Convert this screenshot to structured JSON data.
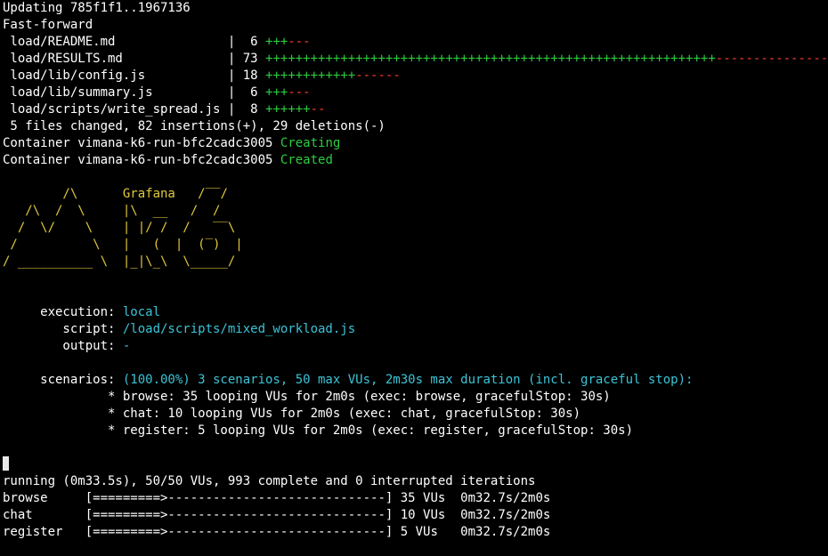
{
  "git": {
    "updating": "Updating 785f1f1..1967136",
    "fast_forward": "Fast-forward",
    "files": [
      {
        "name": " load/README.md              ",
        "sep": " |  ",
        "count": "6",
        "plus": "+++",
        "minus": "---"
      },
      {
        "name": " load/RESULTS.md             ",
        "sep": " | ",
        "count": "73",
        "plus": "++++++++++++++++++++++++++++++++++++++++++++++++++++++++++++",
        "minus": "----------------"
      },
      {
        "name": " load/lib/config.js          ",
        "sep": " | ",
        "count": "18",
        "plus": "++++++++++++",
        "minus": "------"
      },
      {
        "name": " load/lib/summary.js         ",
        "sep": " |  ",
        "count": "6",
        "plus": "+++",
        "minus": "---"
      },
      {
        "name": " load/scripts/write_spread.js",
        "sep": " |  ",
        "count": "8",
        "plus": "++++++",
        "minus": "--"
      }
    ],
    "summary": " 5 files changed, 82 insertions(+), 29 deletions(-)"
  },
  "docker": {
    "lines": [
      {
        "prefix": "Container vimana-k6-run-bfc2cadc3005 ",
        "status": "Creating"
      },
      {
        "prefix": "Container vimana-k6-run-bfc2cadc3005 ",
        "status": "Created"
      }
    ]
  },
  "banner": {
    "line1_a": "        /\\      ",
    "line1_b": "Grafana",
    "line1_c": "   /‾‾/",
    "line2": "   /\\  /  \\     |\\  __   /  /",
    "line3": "  /  \\/    \\    | |/ /  /   ‾‾\\",
    "line4": " /          \\   |   (  |  (‾)  |",
    "line5": "/ __________ \\  |_|\\_\\  \\_____/"
  },
  "config": {
    "execution_label": "     execution: ",
    "execution_value": "local",
    "script_label": "        script: ",
    "script_value": "/load/scripts/mixed_workload.js",
    "output_label": "        output: ",
    "output_value": "-",
    "scenarios_label": "     scenarios: ",
    "scenarios_value": "(100.00%) 3 scenarios, 50 max VUs, 2m30s max duration (incl. graceful stop):",
    "scenario_items": [
      "              * browse: 35 looping VUs for 2m0s (exec: browse, gracefulStop: 30s)",
      "              * chat: 10 looping VUs for 2m0s (exec: chat, gracefulStop: 30s)",
      "              * register: 5 looping VUs for 2m0s (exec: register, gracefulStop: 30s)"
    ]
  },
  "progress": {
    "running": "running (0m33.5s), 50/50 VUs, 993 complete and 0 interrupted iterations",
    "rows": [
      {
        "name": "browse     ",
        "bar": "[=========>-----------------------------]",
        "vus": " 35 VUs",
        "time": "  0m32.7s/2m0s"
      },
      {
        "name": "chat       ",
        "bar": "[=========>-----------------------------]",
        "vus": " 10 VUs",
        "time": "  0m32.7s/2m0s"
      },
      {
        "name": "register   ",
        "bar": "[=========>-----------------------------]",
        "vus": " 5 VUs ",
        "time": "  0m32.7s/2m0s"
      }
    ]
  },
  "colors": {
    "background": "#000000",
    "text": "#ffffff",
    "green": "#2ecc40",
    "red": "#ff3b30",
    "cyan": "#3bc3d6",
    "yellow": "#e0c93a"
  }
}
